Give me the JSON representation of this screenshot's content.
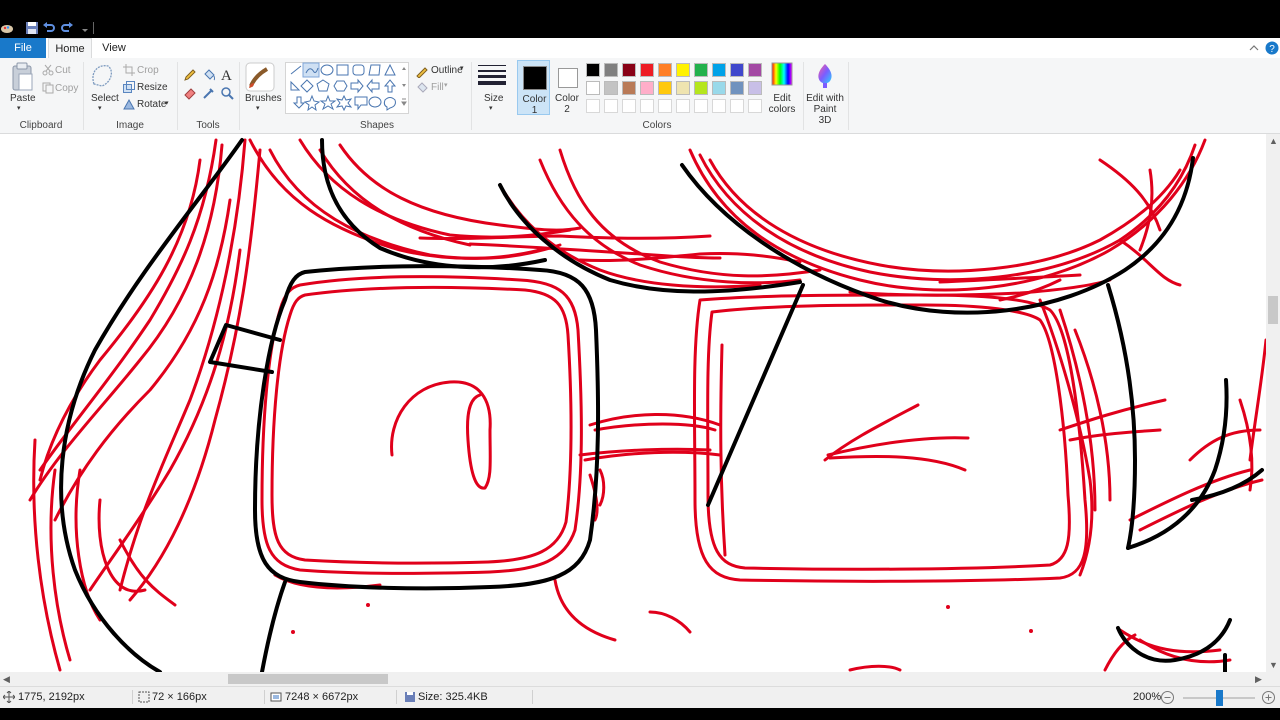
{
  "tabs": {
    "file": "File",
    "home": "Home",
    "view": "View"
  },
  "ribbon": {
    "clipboard": {
      "paste": "Paste",
      "cut": "Cut",
      "copy": "Copy",
      "group": "Clipboard"
    },
    "image": {
      "select": "Select",
      "crop": "Crop",
      "resize": "Resize",
      "rotate": "Rotate",
      "group": "Image"
    },
    "tools": {
      "group": "Tools"
    },
    "brushes": {
      "label": "Brushes"
    },
    "shapes": {
      "outline": "Outline",
      "fill": "Fill",
      "group": "Shapes"
    },
    "size": {
      "label": "Size"
    },
    "color1": {
      "line1": "Color",
      "line2": "1"
    },
    "color2": {
      "line1": "Color",
      "line2": "2"
    },
    "colors": {
      "group": "Colors"
    },
    "edit_colors": {
      "line1": "Edit",
      "line2": "colors"
    },
    "paint3d": {
      "line1": "Edit with",
      "line2": "Paint 3D"
    },
    "palette": [
      "#000000",
      "#7f7f7f",
      "#880015",
      "#ed1c24",
      "#ff7f27",
      "#fff200",
      "#22b14c",
      "#00a2e8",
      "#3f48cc",
      "#a349a4",
      "#ffffff",
      "#c3c3c3",
      "#b97a57",
      "#ffaec9",
      "#ffc90e",
      "#efe4b0",
      "#b5e61d",
      "#99d9ea",
      "#7092be",
      "#c8bfe7",
      "#ffffff",
      "#ffffff",
      "#ffffff",
      "#ffffff",
      "#ffffff",
      "#ffffff",
      "#ffffff",
      "#ffffff",
      "#ffffff",
      "#ffffff"
    ],
    "color1_value": "#000000",
    "color2_value": "#ffffff"
  },
  "status": {
    "cursor_pos": "1775, 2192px",
    "selection_size": "72 × 166px",
    "image_size": "7248 × 6672px",
    "file_size": "Size: 325.4KB",
    "zoom": "200%",
    "zoom_level": 0.5
  },
  "colors": {
    "accent": "#1979ca",
    "stroke_red": "#e0001b",
    "stroke_black": "#000000"
  }
}
